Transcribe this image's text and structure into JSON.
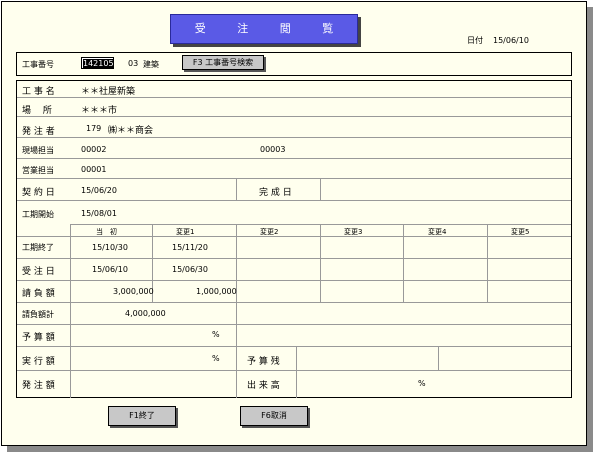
{
  "title": "受 注 閲 覧",
  "date": {
    "label": "日付",
    "value": "15/06/10"
  },
  "koji": {
    "label": "工事番号",
    "input_value": "142105",
    "code": "03",
    "type": "建築",
    "search_button": "F3 工事番号検索"
  },
  "fields": {
    "name": {
      "label": "工 事 名",
      "value": "＊＊社屋新築"
    },
    "place": {
      "label": "場　 所",
      "value": "＊＊＊市"
    },
    "client": {
      "label": "発 注 者",
      "code": "179",
      "value": "㈱＊＊商会"
    },
    "site": {
      "label": "現場担当",
      "value1": "00002",
      "value2": "00003"
    },
    "sales": {
      "label": "営業担当",
      "value": "00001"
    },
    "contract": {
      "label": "契 約 日",
      "value": "15/06/20",
      "complete_label": "完 成 日"
    },
    "start": {
      "label": "工期開始",
      "value": "15/08/01"
    }
  },
  "table": {
    "columns": [
      "当　初",
      "変更1",
      "変更2",
      "変更3",
      "変更4",
      "変更5"
    ],
    "rows": [
      {
        "label": "工期終了",
        "values": [
          "15/10/30",
          "15/11/20"
        ]
      },
      {
        "label": "受 注 日",
        "values": [
          "15/06/10",
          "15/06/30"
        ]
      },
      {
        "label": "請 負 額",
        "values": [
          "3,000,000",
          "1,000,000"
        ]
      }
    ]
  },
  "total": {
    "label": "請負額計",
    "value": "4,000,000"
  },
  "budget": {
    "label": "予 算 額",
    "unit": "%"
  },
  "exec": {
    "label": "実 行 額",
    "unit": "%",
    "rest_label": "予 算 残"
  },
  "order": {
    "label": "発 注 額",
    "done_label": "出 来 高",
    "unit": "%"
  },
  "buttons": {
    "f1": "F1終了",
    "f6": "F6取消"
  }
}
